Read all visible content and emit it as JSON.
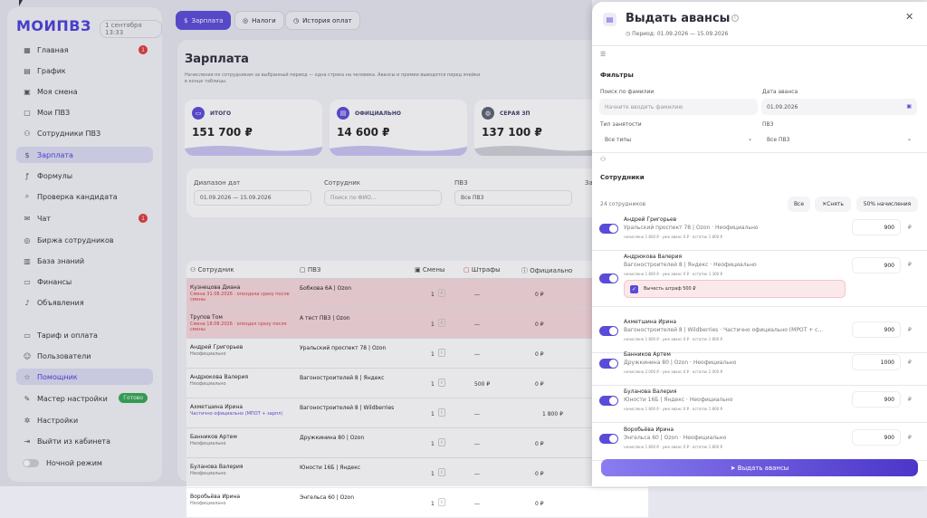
{
  "sidebar": {
    "logo": "МОИПВЗ",
    "date": "1 сентября 13:33",
    "items": [
      {
        "label": "Главная",
        "icon": "grid-icon",
        "badge": "1"
      },
      {
        "label": "График",
        "icon": "chart-icon"
      },
      {
        "label": "Моя смена",
        "icon": "calendar-icon"
      },
      {
        "label": "Мои ПВЗ",
        "icon": "box-icon"
      },
      {
        "label": "Сотрудники ПВЗ",
        "icon": "users-icon"
      },
      {
        "label": "Зарплата",
        "icon": "dollar-icon",
        "active": true
      },
      {
        "label": "Формулы",
        "icon": "formula-icon"
      },
      {
        "label": "Проверка кандидата",
        "icon": "search-icon"
      },
      {
        "label": "Чат",
        "icon": "chat-icon",
        "badge": "1"
      },
      {
        "label": "Биржа сотрудников",
        "icon": "globe-icon"
      },
      {
        "label": "База знаний",
        "icon": "book-icon"
      },
      {
        "label": "Финансы",
        "icon": "wallet-icon"
      },
      {
        "label": "Объявления",
        "icon": "bell-icon"
      },
      {
        "label": "Тариф и оплата",
        "icon": "card-icon"
      },
      {
        "label": "Пользователи",
        "icon": "user-icon"
      },
      {
        "label": "Помощник",
        "icon": "star-icon",
        "active": true
      },
      {
        "label": "Мастер настройки",
        "icon": "wand-icon",
        "badge_text": "Готово"
      },
      {
        "label": "Настройки",
        "icon": "gear-icon"
      },
      {
        "label": "Выйти из кабинета",
        "icon": "logout-icon"
      },
      {
        "label": "Ночной режим",
        "icon": "toggle"
      }
    ]
  },
  "tabs": {
    "salary": "Зарплата",
    "taxes": "Налоги",
    "history": "История оплат"
  },
  "page": {
    "title": "Зарплата",
    "subtitle": "Начисления по сотрудникам за выбранный период — одна строка на человека. Авансы и премии выводятся перед ячейки в конце таблицы."
  },
  "kpi": [
    {
      "label": "ИТОГО",
      "value": "151 700 ₽"
    },
    {
      "label": "ОФИЦИАЛЬНО",
      "value": "14 600 ₽"
    },
    {
      "label": "СЕРАЯ ЗП",
      "value": "137 100 ₽"
    }
  ],
  "filters": {
    "range_label": "Диапазон дат",
    "range_value": "01.09.2026 — 15.09.2026",
    "emp_label": "Сотрудник",
    "emp_ph": "Поиск по ФИО...",
    "pvz_label": "ПВЗ",
    "pvz_value": "Все ПВЗ",
    "extra": "За"
  },
  "table": {
    "headers": {
      "emp": "Сотрудник",
      "pvz": "ПВЗ",
      "shifts": "Смены",
      "fines": "Штрафы",
      "official": "Официально"
    },
    "rows": [
      {
        "name": "Кузнецова Диана",
        "sub": "Смена 31.08.2026 · опоздала сразу после смены",
        "pvz": "Бобкова 6А | Ozon",
        "shifts": "1",
        "fines": "—",
        "official": "0 ₽",
        "off2": "",
        "red": true
      },
      {
        "name": "Трупов Том",
        "sub": "Смена 18.08.2026 · опоздал сразу после смены",
        "pvz": "А тест ПВЗ | Ozon",
        "shifts": "1",
        "fines": "—",
        "official": "0 ₽",
        "off2": "",
        "red": true
      },
      {
        "name": "Андрей Григорьев",
        "sub": "Неофициально",
        "pvz": "Уральский проспект 78 | Ozon",
        "shifts": "1",
        "fines": "—",
        "official": "0 ₽",
        "off2": ""
      },
      {
        "name": "Андрюкова Валерия",
        "sub": "Неофициально",
        "pvz": "Вагоностроителей 8 | Яндекс",
        "shifts": "1",
        "fines": "500 ₽",
        "official": "0 ₽",
        "off2": ""
      },
      {
        "name": "Ахметшина Ирина",
        "sub": "Частично официально (МПОТ + зарпл)",
        "pvz": "Вагоностроителей 8 | Wildberries",
        "shifts": "1",
        "fines": "—",
        "official": "",
        "off2": "1 800 ₽",
        "purple": true
      },
      {
        "name": "Банников Артем",
        "sub": "Неофициально",
        "pvz": "Дружкинина 80 | Ozon",
        "shifts": "1",
        "fines": "—",
        "official": "0 ₽",
        "off2": ""
      },
      {
        "name": "Буланова Валерия",
        "sub": "Неофициально",
        "pvz": "Юности 16Б | Яндекс",
        "shifts": "1",
        "fines": "—",
        "official": "0 ₽",
        "off2": ""
      },
      {
        "name": "Воробьёва Ирина",
        "sub": "Неофициально",
        "pvz": "Энгельса 60 | Ozon",
        "shifts": "1",
        "fines": "—",
        "official": "0 ₽",
        "off2": ""
      }
    ]
  },
  "drawer": {
    "title": "Выдать авансы",
    "period": "Период: 01.09.2026 — 15.09.2026",
    "filters_title": "Фильтры",
    "search_label": "Поиск по фамилии",
    "search_ph": "Начните вводить фамилию",
    "date_label": "Дата аванса",
    "date_value": "01.09.2026",
    "type_label": "Тип занятости",
    "type_value": "Все типы",
    "pvz_label": "ПВЗ",
    "pvz_value": "Все ПВЗ",
    "employees_title": "Сотрудники",
    "count": "24 сотрудников",
    "btn_all": "Все",
    "btn_clear": "Снять",
    "btn_half": "50% начисления",
    "fine_checkbox": "Вычесть штраф 500 ₽",
    "submit": "Выдать авансы",
    "employees": [
      {
        "name": "Андрей Григорьев",
        "pvz": "Уральский проспект 78 | Ozon · Неофициально",
        "details": "начислено 1 800 ₽ · уже аванс 0 ₽ · остаток 1 800 ₽",
        "amount": "900",
        "currency": "₽"
      },
      {
        "name": "Андрюкова Валерия",
        "pvz": "Вагоностроителей 8 | Яндекс · Неофициально",
        "details": "начислено 1 800 ₽ · уже аванс 0 ₽ · остаток 1 300 ₽",
        "amount": "900",
        "currency": "₽"
      },
      {
        "name": "Ахметшина Ирина",
        "pvz": "Вагоностроителей 8 | Wildberries · Частично официально (МРОТ + с...",
        "details": "начислено 1 800 ₽ · уже аванс 0 ₽ · остаток 1 800 ₽",
        "amount": "900",
        "currency": "₽"
      },
      {
        "name": "Банников Артем",
        "pvz": "Дружкинина 80 | Ozon · Неофициально",
        "details": "начислено 2 000 ₽ · уже аванс 0 ₽ · остаток 2 000 ₽",
        "amount": "1000",
        "currency": "₽"
      },
      {
        "name": "Буланова Валерия",
        "pvz": "Юности 16Б | Яндекс · Неофициально",
        "details": "начислено 1 800 ₽ · уже аванс 0 ₽ · остаток 1 800 ₽",
        "amount": "900",
        "currency": "₽"
      },
      {
        "name": "Воробьёва Ирина",
        "pvz": "Энгельса 60 | Ozon · Неофициально",
        "details": "начислено 1 800 ₽ · уже аванс 0 ₽ · остаток 1 800 ₽",
        "amount": "900",
        "currency": "₽"
      }
    ]
  },
  "colors": {
    "accent": "#5a4bd8",
    "danger": "#e03b3b",
    "fine_row": "#f7d9dc"
  }
}
